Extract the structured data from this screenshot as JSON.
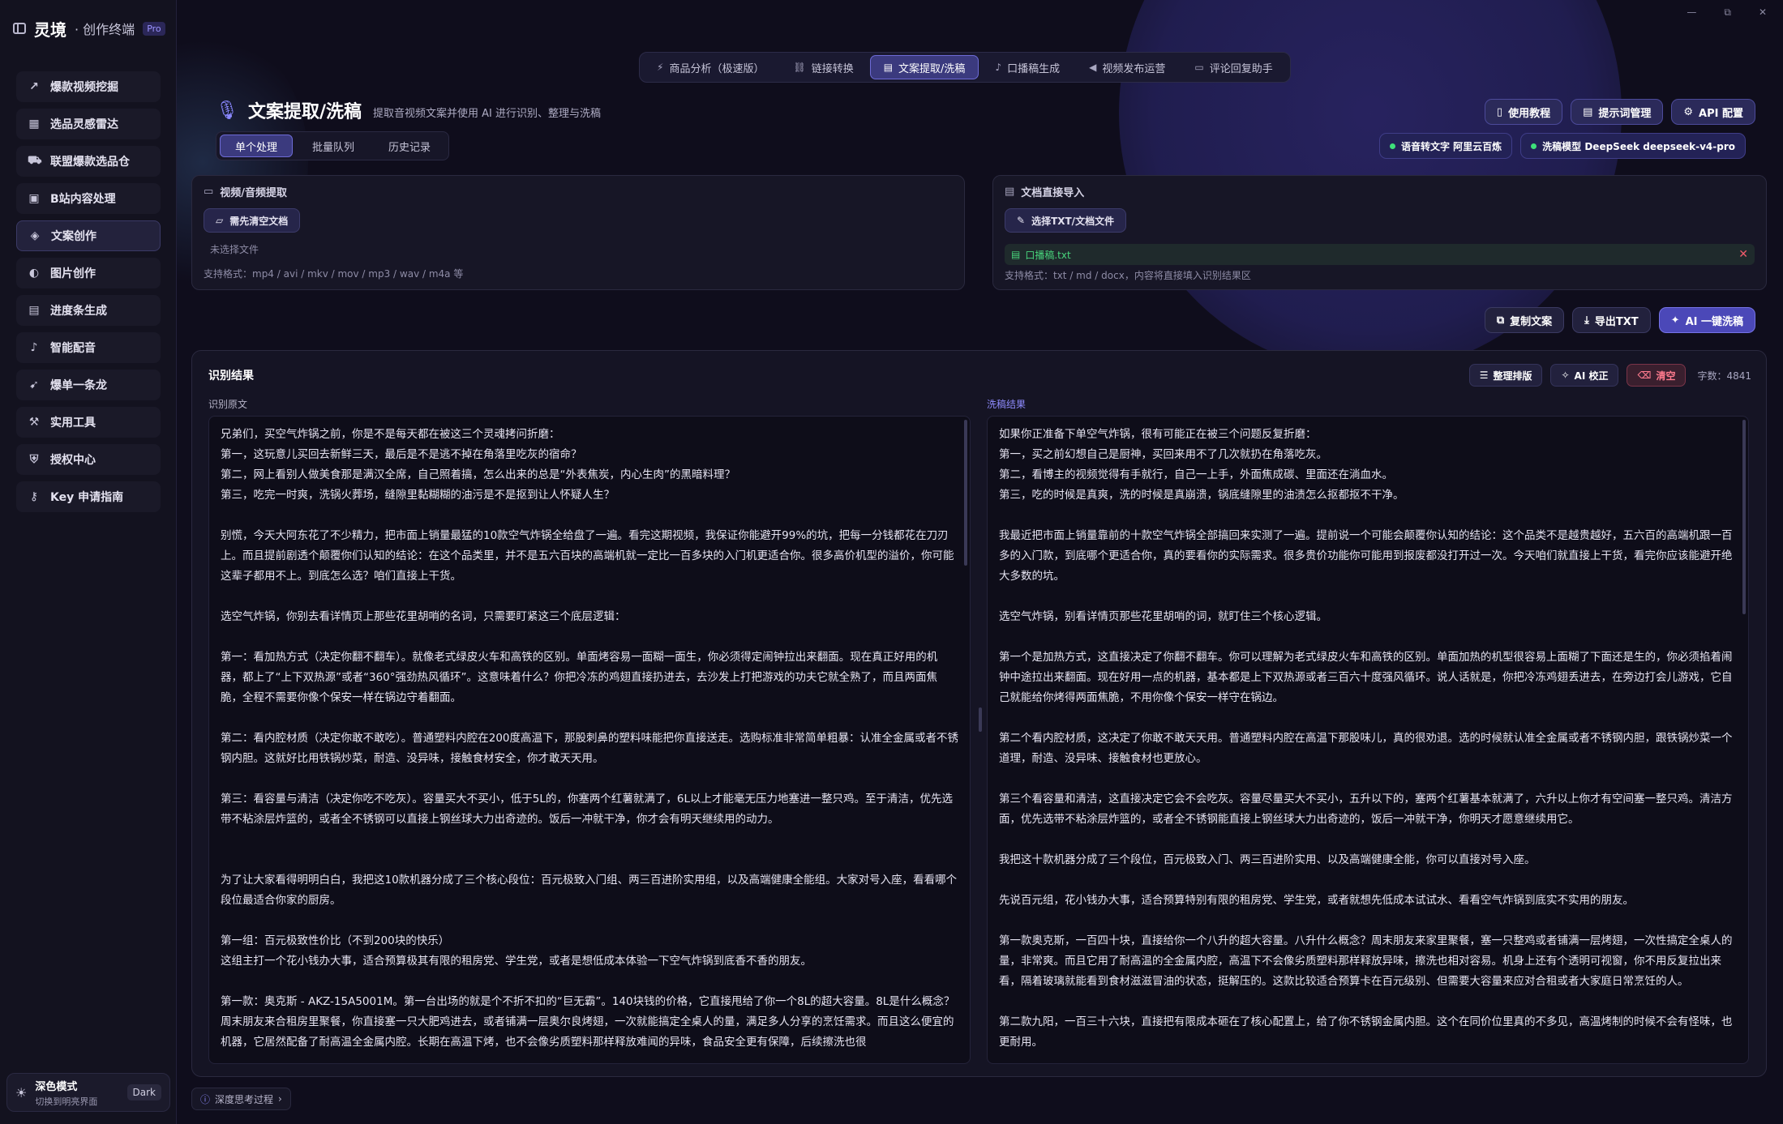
{
  "window": {
    "controls": [
      "—",
      "⧉",
      "✕"
    ]
  },
  "brand": {
    "name": "灵境",
    "sub": "· 创作终端",
    "badge": "Pro"
  },
  "sidebar": {
    "items": [
      {
        "label": "爆款视频挖掘",
        "icon": "trending-icon",
        "glyph": "↗"
      },
      {
        "label": "选品灵感雷达",
        "icon": "calendar-icon",
        "glyph": "▦"
      },
      {
        "label": "联盟爆款选品仓",
        "icon": "cart-icon",
        "glyph": "⛟"
      },
      {
        "label": "B站内容处理",
        "icon": "tv-icon",
        "glyph": "▣"
      },
      {
        "label": "文案创作",
        "icon": "tag-icon",
        "glyph": "◈",
        "active": true
      },
      {
        "label": "图片创作",
        "icon": "palette-icon",
        "glyph": "◐"
      },
      {
        "label": "进度条生成",
        "icon": "grid-icon",
        "glyph": "▤"
      },
      {
        "label": "智能配音",
        "icon": "mic-icon",
        "glyph": "♪"
      },
      {
        "label": "爆单一条龙",
        "icon": "rocket-icon",
        "glyph": "➹"
      },
      {
        "label": "实用工具",
        "icon": "wrench-icon",
        "glyph": "⚒"
      },
      {
        "label": "授权中心",
        "icon": "shield-icon",
        "glyph": "⛨"
      },
      {
        "label": "Key 申请指南",
        "icon": "key-icon",
        "glyph": "⚷"
      }
    ],
    "theme": {
      "title": "深色模式",
      "sub": "切换到明亮界面",
      "badge": "Dark"
    }
  },
  "toptabs": [
    {
      "label": "商品分析（极速版）",
      "glyph": "⚡"
    },
    {
      "label": "链接转换",
      "glyph": "⛓"
    },
    {
      "label": "文案提取/洗稿",
      "glyph": "▤",
      "active": true
    },
    {
      "label": "口播稿生成",
      "glyph": "♪"
    },
    {
      "label": "视频发布运营",
      "glyph": "◀"
    },
    {
      "label": "评论回复助手",
      "glyph": "▭"
    }
  ],
  "page": {
    "title": "文案提取/洗稿",
    "subtitle": "提取音视频文案并使用 AI 进行识别、整理与洗稿",
    "subtabs": [
      "单个处理",
      "批量队列",
      "历史记录"
    ]
  },
  "header_buttons": [
    {
      "label": "使用教程",
      "glyph": "▯"
    },
    {
      "label": "提示词管理",
      "glyph": "▤"
    },
    {
      "label": "API 配置",
      "glyph": "⚙"
    }
  ],
  "models": [
    {
      "label": "语音转文字 阿里云百炼"
    },
    {
      "label": "洗稿模型 DeepSeek deepseek-v4-pro"
    }
  ],
  "media_panel": {
    "title": "视频/音频提取",
    "button": "需先清空文档",
    "status": "未选择文件",
    "formats": "支持格式：mp4 / avi / mkv / mov / mp3 / wav / m4a 等"
  },
  "doc_panel": {
    "title": "文档直接导入",
    "button": "选择TXT/文档文件",
    "file": "口播稿.txt",
    "formats": "支持格式：txt / md / docx，内容将直接填入识别结果区"
  },
  "actions": [
    {
      "label": "复制文案",
      "glyph": "⧉"
    },
    {
      "label": "导出TXT",
      "glyph": "⤓"
    },
    {
      "label": "AI 一键洗稿",
      "glyph": "✦",
      "primary": true
    }
  ],
  "result": {
    "title": "识别结果",
    "tools": [
      {
        "label": "整理排版",
        "glyph": "☰"
      },
      {
        "label": "AI 校正",
        "glyph": "✧"
      },
      {
        "label": "清空",
        "glyph": "⌫",
        "danger": true
      }
    ],
    "word_count": "字数：4841",
    "original_label": "识别原文",
    "rewrite_label": "洗稿结果",
    "original": [
      "兄弟们，买空气炸锅之前，你是不是每天都在被这三个灵魂拷问折磨：\n第一，这玩意儿买回去新鲜三天，最后是不是逃不掉在角落里吃灰的宿命？\n第二，网上看别人做美食那是满汉全席，自己照着搞，怎么出来的总是“外表焦炭，内心生肉”的黑暗料理？\n第三，吃完一时爽，洗锅火葬场，缝隙里黏糊糊的油污是不是抠到让人怀疑人生？",
      "别慌，今天大阿东花了不少精力，把市面上销量最猛的10款空气炸锅全给盘了一遍。看完这期视频，我保证你能避开99%的坑，把每一分钱都花在刀刃上。而且提前剧透个颠覆你们认知的结论：在这个品类里，并不是五六百块的高端机就一定比一百多块的入门机更适合你。很多高价机型的溢价，你可能这辈子都用不上。到底怎么选？咱们直接上干货。",
      "选空气炸锅，你别去看详情页上那些花里胡哨的名词，只需要盯紧这三个底层逻辑：",
      "第一：看加热方式（决定你翻不翻车）。就像老式绿皮火车和高铁的区别。单面烤容易一面糊一面生，你必须得定闹钟拉出来翻面。现在真正好用的机器，都上了“上下双热源”或者“360°强劲热风循环”。这意味着什么？你把冷冻的鸡翅直接扔进去，去沙发上打把游戏的功夫它就全熟了，而且两面焦脆，全程不需要你像个保安一样在锅边守着翻面。",
      "第二：看内腔材质（决定你敢不敢吃）。普通塑料内腔在200度高温下，那股刺鼻的塑料味能把你直接送走。选购标准非常简单粗暴：认准全金属或者不锈钢内胆。这就好比用铁锅炒菜，耐造、没异味，接触食材安全，你才敢天天用。",
      "第三：看容量与清洁（决定你吃不吃灰）。容量买大不买小，低于5L的，你塞两个红薯就满了，6L以上才能毫无压力地塞进一整只鸡。至于清洁，优先选带不粘涂层炸篮的，或者全不锈钢可以直接上钢丝球大力出奇迹的。饭后一冲就干净，你才会有明天继续用的动力。",
      "\n为了让大家看得明明白白，我把这10款机器分成了三个核心段位：百元极致入门组、两三百进阶实用组，以及高端健康全能组。大家对号入座，看看哪个段位最适合你家的厨房。",
      "第一组：百元极致性价比（不到200块的快乐）\n这组主打一个花小钱办大事，适合预算极其有限的租房党、学生党，或者是想低成本体验一下空气炸锅到底香不香的朋友。",
      "第一款：奥克斯 - AKZ-15A5001M。第一台出场的就是个不折不扣的“巨无霸”。140块钱的价格，它直接甩给了你一个8L的超大容量。8L是什么概念？周末朋友来合租房里聚餐，你直接塞一只大肥鸡进去，或者铺满一层奥尔良烤翅，一次就能搞定全桌人的量，满足多人分享的烹饪需求。而且这么便宜的机器，它居然配备了耐高温全金属内腔。长期在高温下烤，也不会像劣质塑料那样释放难闻的异味，食品安全更有保障，后续擦洗也很"
    ],
    "rewrite": [
      "如果你正准备下单空气炸锅，很有可能正在被三个问题反复折磨：\n第一，买之前幻想自己是厨神，买回来用不了几次就扔在角落吃灰。\n第二，看博主的视频觉得有手就行，自己一上手，外面焦成碳、里面还在淌血水。\n第三，吃的时候是真爽，洗的时候是真崩溃，锅底缝隙里的油渍怎么抠都抠不干净。",
      "我最近把市面上销量靠前的十款空气炸锅全部搞回来实测了一遍。提前说一个可能会颠覆你认知的结论：这个品类不是越贵越好，五六百的高端机跟一百多的入门款，到底哪个更适合你，真的要看你的实际需求。很多贵价功能你可能用到报废都没打开过一次。今天咱们就直接上干货，看完你应该能避开绝大多数的坑。",
      "选空气炸锅，别看详情页那些花里胡哨的词，就盯住三个核心逻辑。",
      "第一个是加热方式，这直接决定了你翻不翻车。你可以理解为老式绿皮火车和高铁的区别。单面加热的机型很容易上面糊了下面还是生的，你必须掐着闹钟中途拉出来翻面。现在好用一点的机器，基本都是上下双热源或者三百六十度强风循环。说人话就是，你把冷冻鸡翅丢进去，在旁边打会儿游戏，它自己就能给你烤得两面焦脆，不用你像个保安一样守在锅边。",
      "第二个看内腔材质，这决定了你敢不敢天天用。普通塑料内腔在高温下那股味儿，真的很劝退。选的时候就认准全金属或者不锈钢内胆，跟铁锅炒菜一个道理，耐造、没异味、接触食材也更放心。",
      "第三个看容量和清洁，这直接决定它会不会吃灰。容量尽量买大不买小，五升以下的，塞两个红薯基本就满了，六升以上你才有空间塞一整只鸡。清洁方面，优先选带不粘涂层炸篮的，或者全不锈钢能直接上钢丝球大力出奇迹的，饭后一冲就干净，你明天才愿意继续用它。",
      "我把这十款机器分成了三个段位，百元极致入门、两三百进阶实用、以及高端健康全能，你可以直接对号入座。",
      "先说百元组，花小钱办大事，适合预算特别有限的租房党、学生党，或者就想先低成本试试水、看看空气炸锅到底实不实用的朋友。",
      "第一款奥克斯，一百四十块，直接给你一个八升的超大容量。八升什么概念？周末朋友来家里聚餐，塞一只整鸡或者铺满一层烤翅，一次性搞定全桌人的量，非常爽。而且它用了耐高温的全金属内腔，高温下不会像劣质塑料那样释放异味，擦洗也相对容易。机身上还有个透明可视窗，你不用反复拉出来看，隔着玻璃就能看到食材滋滋冒油的状态，挺解压的。这款比较适合预算卡在百元级别、但需要大容量来应对合租或者大家庭日常烹饪的人。",
      "第二款九阳，一百三十六块，直接把有限成本砸在了核心配置上，给了你不锈钢金属内胆。这个在同价位里真的不多见，高温烤制的时候不会有怪味，也更耐用。"
    ]
  },
  "bottom": {
    "label": "深度思考过程"
  }
}
